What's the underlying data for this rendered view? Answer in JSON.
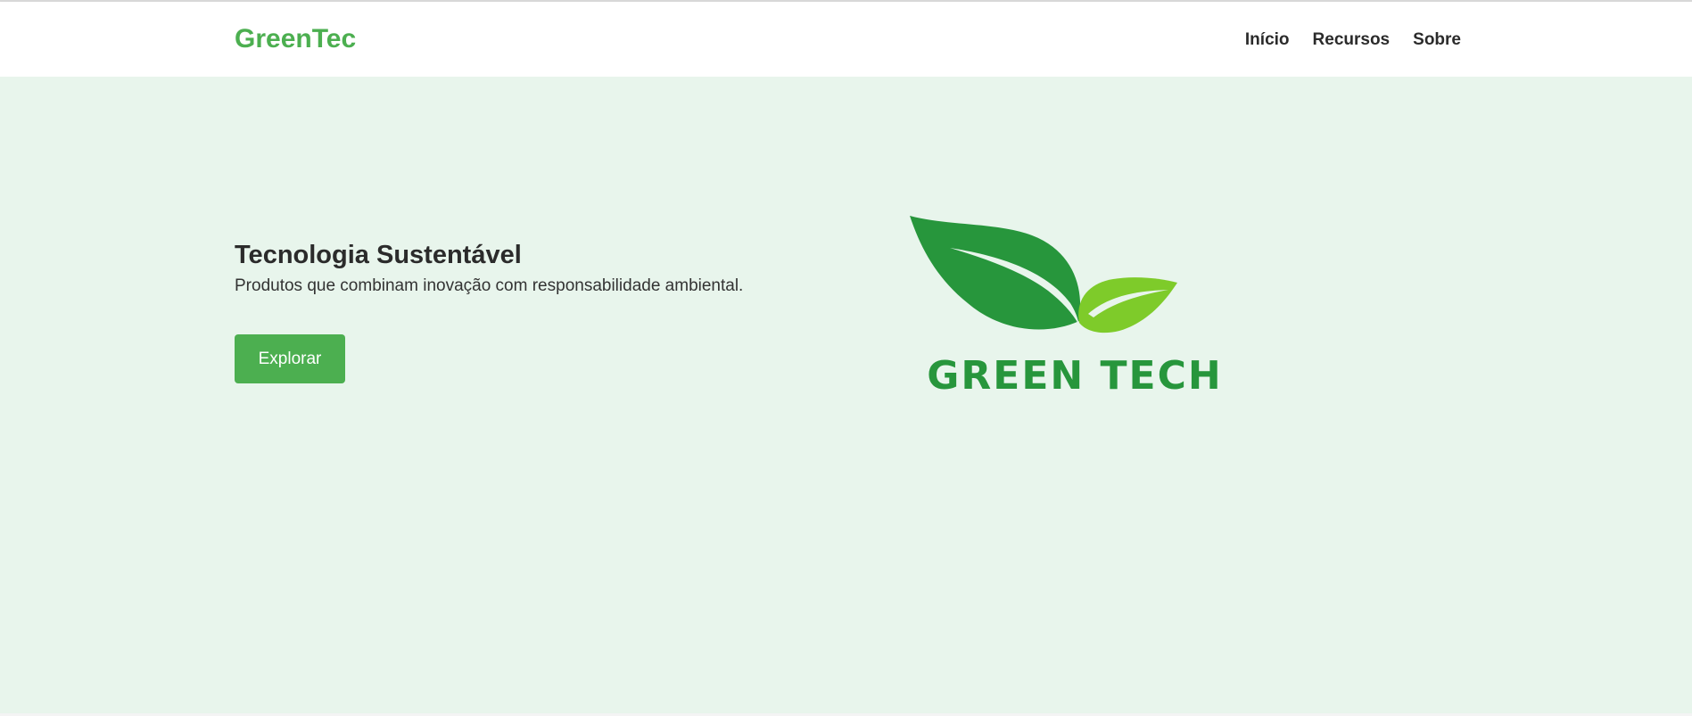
{
  "header": {
    "brand": "GreenTec",
    "nav": [
      "Início",
      "Recursos",
      "Sobre"
    ]
  },
  "hero": {
    "title": "Tecnologia Sustentável",
    "subtitle": "Produtos que combinam inovação com responsabilidade ambiental.",
    "cta_label": "Explorar"
  },
  "logo": {
    "text": "GREEN TECH",
    "icon": "leaf-icon"
  },
  "colors": {
    "brand": "#4caf50",
    "background": "#e8f5ec",
    "leaf_dark": "#27963c",
    "leaf_light": "#7ecb2a"
  }
}
